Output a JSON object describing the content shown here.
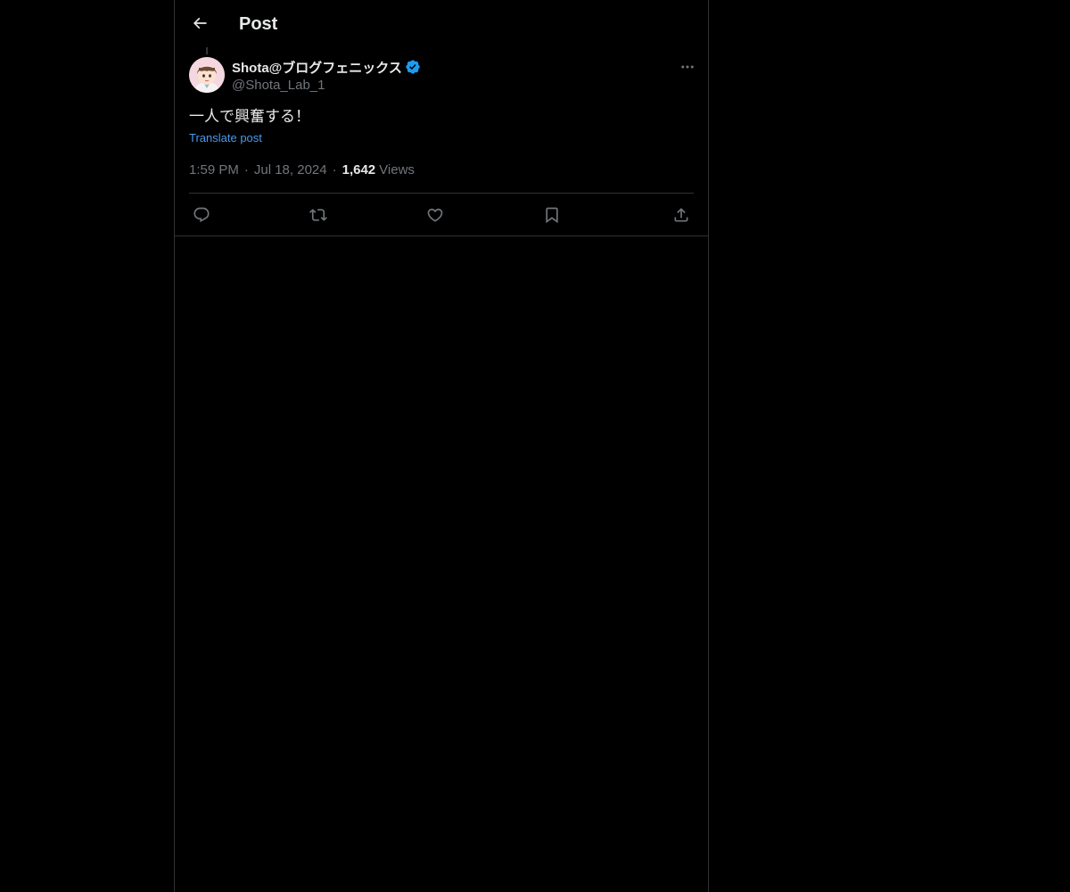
{
  "header": {
    "title": "Post",
    "back_icon": "arrow-left-icon"
  },
  "post": {
    "author": {
      "display_name": "Shota@ブログフェニックス",
      "handle": "@Shota_Lab_1",
      "verified": true,
      "verified_color": "#1d9bf0"
    },
    "text": "一人で興奮する！",
    "translate_label": "Translate post",
    "time": "1:59 PM",
    "separator": "·",
    "date": "Jul 18, 2024",
    "views_count": "1,642",
    "views_label": "Views"
  },
  "actions": [
    {
      "name": "reply",
      "icon": "reply-icon"
    },
    {
      "name": "repost",
      "icon": "repost-icon"
    },
    {
      "name": "like",
      "icon": "heart-icon"
    },
    {
      "name": "bookmark",
      "icon": "bookmark-icon"
    },
    {
      "name": "share",
      "icon": "share-icon"
    }
  ],
  "colors": {
    "background": "#000000",
    "text_primary": "#e7e9ea",
    "text_secondary": "#71767b",
    "link": "#4a99e9",
    "border": "#2f3336"
  }
}
